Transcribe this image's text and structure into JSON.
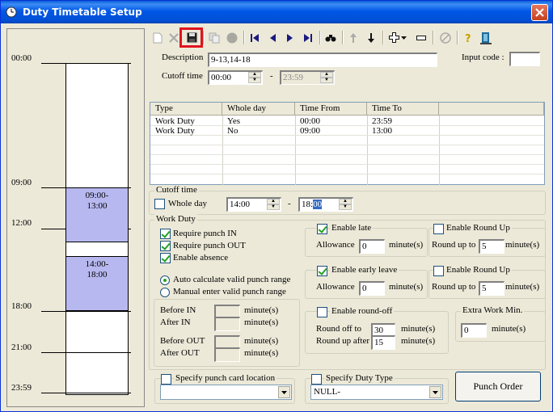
{
  "window": {
    "title": "Duty Timetable Setup"
  },
  "timeline": {
    "labels": [
      "00:00",
      "09:00",
      "12:00",
      "18:00",
      "21:00",
      "23:59"
    ],
    "blocks": [
      {
        "from": "09:00-",
        "to": "13:00"
      },
      {
        "from": "14:00-",
        "to": "18:00"
      }
    ]
  },
  "toolbar": {
    "icons": [
      "new-icon",
      "delete-icon",
      "save-icon",
      "copy-icon",
      "stop-icon",
      "first-record-icon",
      "previous-record-icon",
      "next-record-icon",
      "last-record-icon",
      "find-icon",
      "move-up-icon",
      "move-down-icon",
      "add-icon",
      "dropdown-icon",
      "remove-icon",
      "disabled-icon",
      "help-icon",
      "exit-icon"
    ]
  },
  "header": {
    "description_label": "Description",
    "description_value": "9-13,14-18",
    "input_code_label": "Input code :",
    "input_code_value": "",
    "cutoff_label": "Cutoff time",
    "cutoff_from": "00:00",
    "cutoff_dash": "-",
    "cutoff_to": "23:59"
  },
  "grid": {
    "columns": [
      "Type",
      "Whole day",
      "Time From",
      "Time To"
    ],
    "rows": [
      [
        "Work Duty",
        "Yes",
        "00:00",
        "23:59"
      ],
      [
        "Work Duty",
        "No",
        "09:00",
        "13:00"
      ]
    ]
  },
  "cutoff_group": {
    "title": "Cutoff time",
    "whole_day_label": "Whole day",
    "from": "14:00",
    "dash": "-",
    "to_hour": "18:",
    "to_minute": "00"
  },
  "work_duty": {
    "title": "Work Duty",
    "require_in": "Require punch IN",
    "require_out": "Require punch OUT",
    "enable_absence": "Enable absence",
    "auto_calc": "Auto calculate valid punch range",
    "manual_enter": "Manual enter valid punch range",
    "before_in": "Before IN",
    "after_in": "After IN",
    "before_out": "Before OUT",
    "after_out": "After OUT",
    "minutes": "minute(s)"
  },
  "late": {
    "enable_late": "Enable late",
    "allowance_label": "Allowance",
    "allowance_value": "0",
    "minutes": "minute(s)",
    "enable_round_up": "Enable Round Up",
    "round_up_to_label": "Round up to",
    "round_up_to_value": "5"
  },
  "early": {
    "enable_early": "Enable early leave",
    "allowance_label": "Allowance",
    "allowance_value": "0",
    "minutes": "minute(s)",
    "enable_round_up": "Enable Round Up",
    "round_up_to_label": "Round up to",
    "round_up_to_value": "5"
  },
  "roundoff": {
    "enable": "Enable round-off",
    "round_off_to_label": "Round off to",
    "round_off_to_value": "30",
    "round_up_after_label": "Round up after",
    "round_up_after_value": "15",
    "minutes": "minute(s)"
  },
  "extra": {
    "title": "Extra Work Min.",
    "value": "0",
    "minutes": "minute(s)"
  },
  "bottom": {
    "punch_location_label": "Specify punch card location",
    "punch_location_value": "",
    "duty_type_label": "Specify Duty Type",
    "duty_type_value": "NULL-",
    "punch_order_button": "Punch Order"
  }
}
